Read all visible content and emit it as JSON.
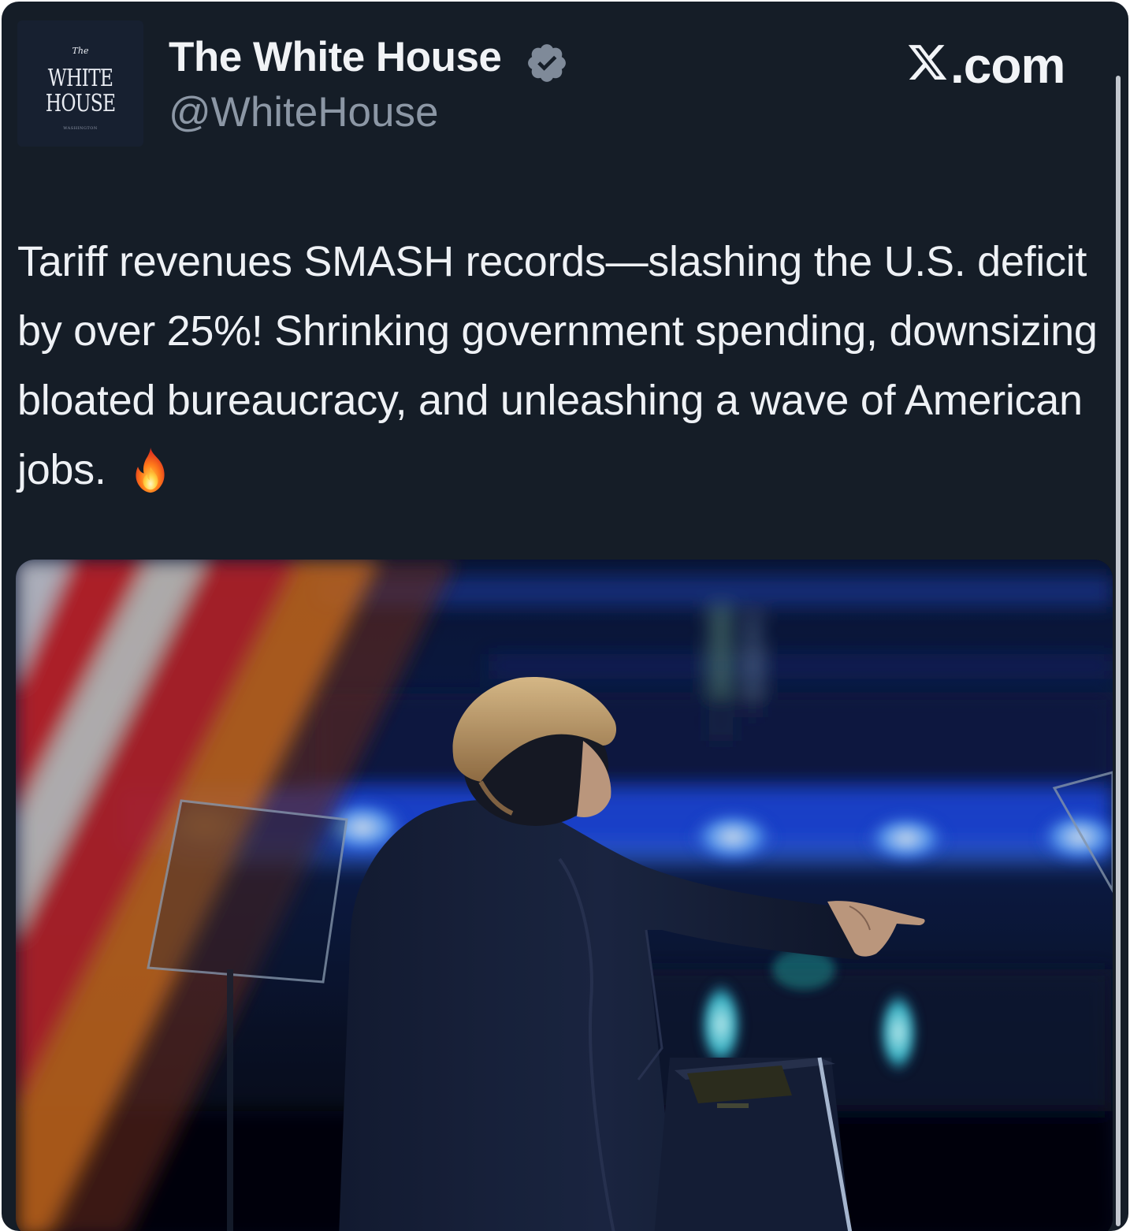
{
  "post": {
    "avatar": {
      "line_the": "The",
      "line_white": "WHITE",
      "line_house": "HOUSE",
      "line_washington": "WASHINGTON"
    },
    "author_name": "The White House",
    "verified_badge_icon": "verified-check-icon",
    "handle": "@WhiteHouse",
    "platform": "X.com",
    "platform_text": ".com",
    "platform_icon": "x-logo-icon",
    "text": "Tariff revenues SMASH records—slashing the U.S. deficit by over 25%! Shrinking government spending, downsizing bloated bureaucracy, and unleashing a wave of American jobs.",
    "emoji_icon": "fire-emoji-icon"
  },
  "colors": {
    "background": "#151d27",
    "text_primary": "#eef1f5",
    "text_secondary": "#8c97a5",
    "verified_badge": "#7f8a99"
  }
}
